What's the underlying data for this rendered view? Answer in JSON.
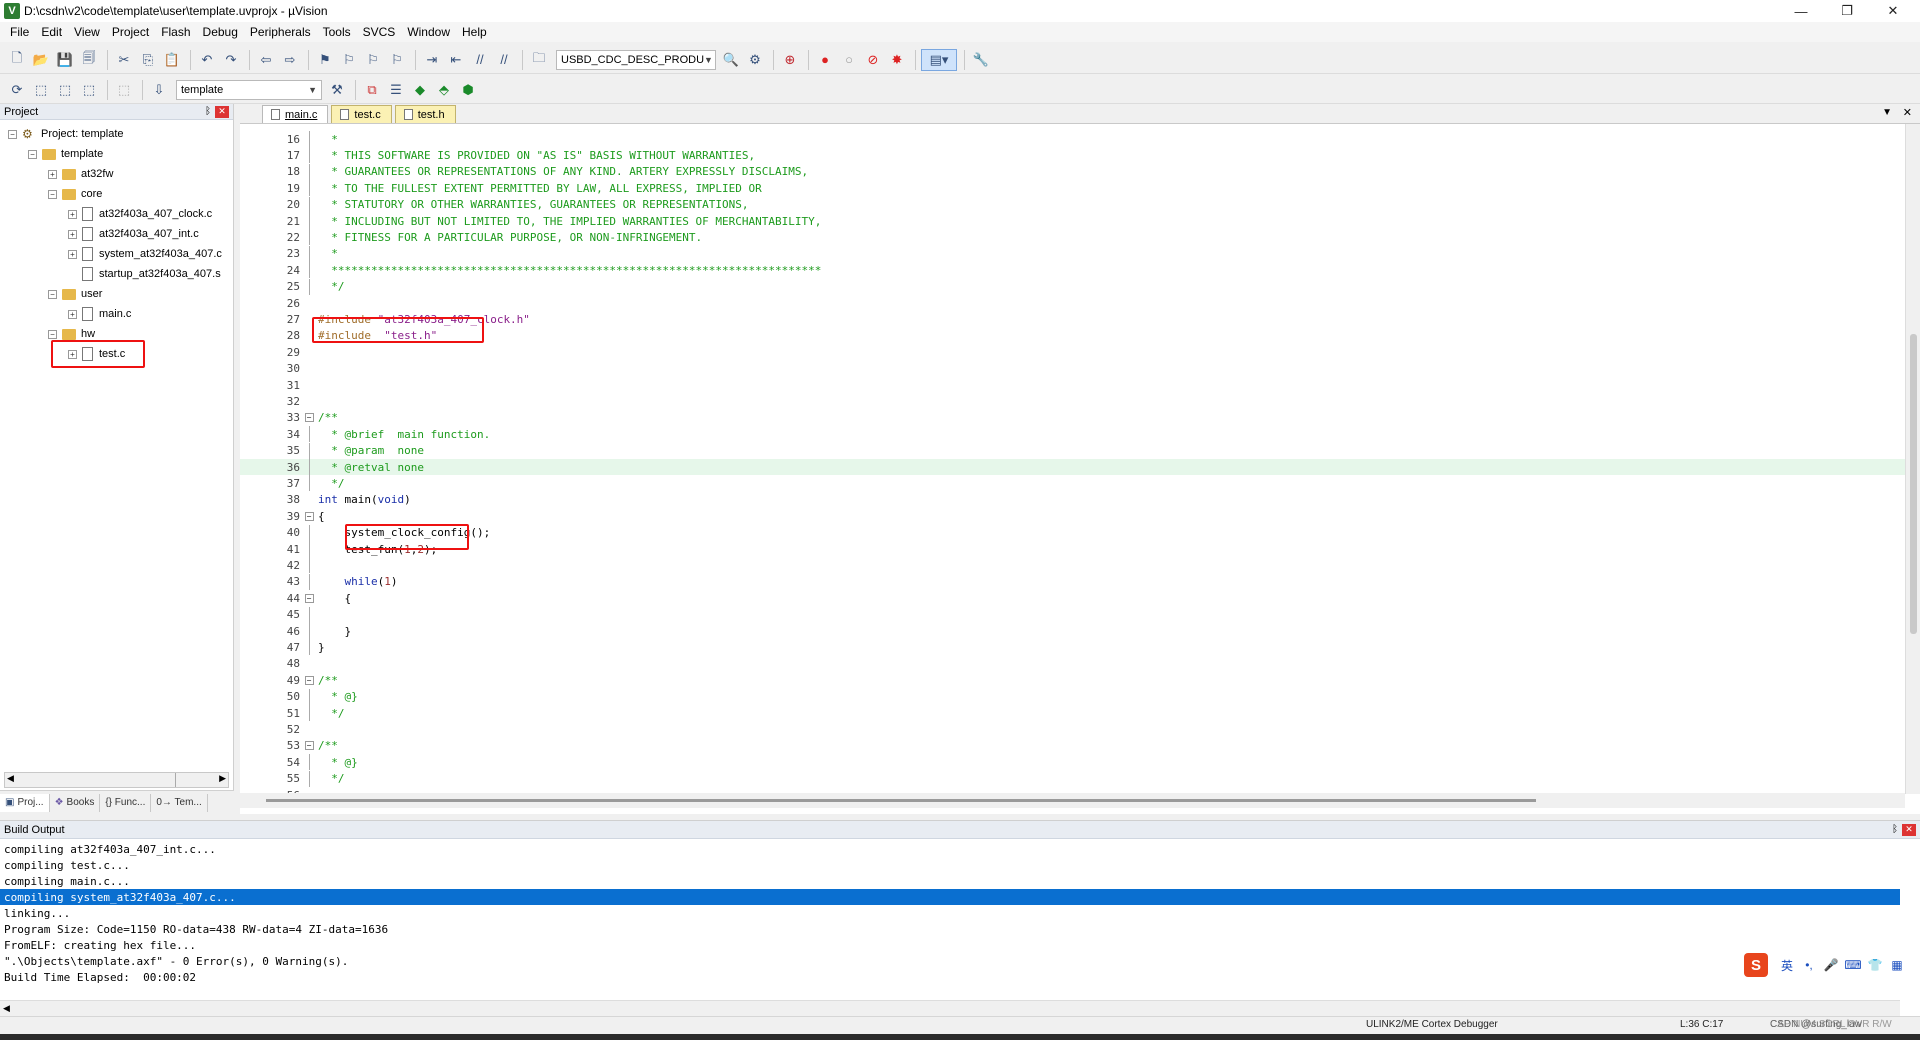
{
  "window": {
    "title": "D:\\csdn\\v2\\code\\template\\user\\template.uvprojx - µVision",
    "icon_letter": "V",
    "controls": {
      "minimize": "—",
      "maximize": "❐",
      "close": "✕"
    }
  },
  "menu": [
    "File",
    "Edit",
    "View",
    "Project",
    "Flash",
    "Debug",
    "Peripherals",
    "Tools",
    "SVCS",
    "Window",
    "Help"
  ],
  "toolbar1": {
    "target_dropdown": "USBD_CDC_DESC_PRODU"
  },
  "toolbar2": {
    "target_select": "template"
  },
  "project_panel": {
    "title": "Project",
    "pin": "ᛒ",
    "close": "✕",
    "tree": [
      {
        "label": "Project: template",
        "level": 0,
        "kind": "project",
        "exp": "−"
      },
      {
        "label": "template",
        "level": 1,
        "kind": "folder",
        "exp": "−"
      },
      {
        "label": "at32fw",
        "level": 2,
        "kind": "folder",
        "exp": "+"
      },
      {
        "label": "core",
        "level": 2,
        "kind": "folder",
        "exp": "−"
      },
      {
        "label": "at32f403a_407_clock.c",
        "level": 3,
        "kind": "file",
        "exp": "+"
      },
      {
        "label": "at32f403a_407_int.c",
        "level": 3,
        "kind": "file",
        "exp": "+"
      },
      {
        "label": "system_at32f403a_407.c",
        "level": 3,
        "kind": "file",
        "exp": "+"
      },
      {
        "label": "startup_at32f403a_407.s",
        "level": 3,
        "kind": "file",
        "exp": ""
      },
      {
        "label": "user",
        "level": 2,
        "kind": "folder",
        "exp": "−"
      },
      {
        "label": "main.c",
        "level": 3,
        "kind": "file",
        "exp": "+"
      },
      {
        "label": "hw",
        "level": 2,
        "kind": "folder",
        "exp": "−"
      },
      {
        "label": "test.c",
        "level": 3,
        "kind": "file",
        "exp": "+"
      }
    ],
    "bottom_tabs": [
      "Proj...",
      "Books",
      "{} Func...",
      "0→ Tem..."
    ]
  },
  "editor": {
    "tabs": [
      {
        "label": "main.c",
        "active": true
      },
      {
        "label": "test.c",
        "active": false
      },
      {
        "label": "test.h",
        "active": false
      }
    ],
    "lines": [
      {
        "n": "16",
        "fold": "line",
        "segs": [
          {
            "t": "  *",
            "c": "comment"
          }
        ]
      },
      {
        "n": "17",
        "fold": "line",
        "segs": [
          {
            "t": "  * THIS SOFTWARE IS PROVIDED ON \"AS IS\" BASIS WITHOUT WARRANTIES,",
            "c": "comment"
          }
        ]
      },
      {
        "n": "18",
        "fold": "line",
        "segs": [
          {
            "t": "  * GUARANTEES OR REPRESENTATIONS OF ANY KIND. ARTERY EXPRESSLY DISCLAIMS,",
            "c": "comment"
          }
        ]
      },
      {
        "n": "19",
        "fold": "line",
        "segs": [
          {
            "t": "  * TO THE FULLEST EXTENT PERMITTED BY LAW, ALL EXPRESS, IMPLIED OR",
            "c": "comment"
          }
        ]
      },
      {
        "n": "20",
        "fold": "line",
        "segs": [
          {
            "t": "  * STATUTORY OR OTHER WARRANTIES, GUARANTEES OR REPRESENTATIONS,",
            "c": "comment"
          }
        ]
      },
      {
        "n": "21",
        "fold": "line",
        "segs": [
          {
            "t": "  * INCLUDING BUT NOT LIMITED TO, THE IMPLIED WARRANTIES OF MERCHANTABILITY,",
            "c": "comment"
          }
        ]
      },
      {
        "n": "22",
        "fold": "line",
        "segs": [
          {
            "t": "  * FITNESS FOR A PARTICULAR PURPOSE, OR NON-INFRINGEMENT.",
            "c": "comment"
          }
        ]
      },
      {
        "n": "23",
        "fold": "line",
        "segs": [
          {
            "t": "  *",
            "c": "comment"
          }
        ]
      },
      {
        "n": "24",
        "fold": "line",
        "segs": [
          {
            "t": "  **************************************************************************",
            "c": "comment"
          }
        ]
      },
      {
        "n": "25",
        "fold": "line",
        "segs": [
          {
            "t": "  */",
            "c": "comment"
          }
        ]
      },
      {
        "n": "26",
        "fold": "",
        "segs": []
      },
      {
        "n": "27",
        "fold": "",
        "segs": [
          {
            "t": "#include ",
            "c": "pp"
          },
          {
            "t": "\"at32f403a_407_clock.h\"",
            "c": "str"
          }
        ]
      },
      {
        "n": "28",
        "fold": "",
        "segs": [
          {
            "t": "#include  ",
            "c": "pp"
          },
          {
            "t": "\"test.h\"",
            "c": "str"
          }
        ]
      },
      {
        "n": "29",
        "fold": "",
        "segs": []
      },
      {
        "n": "30",
        "fold": "",
        "segs": []
      },
      {
        "n": "31",
        "fold": "",
        "segs": []
      },
      {
        "n": "32",
        "fold": "",
        "segs": []
      },
      {
        "n": "33",
        "fold": "box",
        "segs": [
          {
            "t": "/**",
            "c": "comment"
          }
        ]
      },
      {
        "n": "34",
        "fold": "line",
        "segs": [
          {
            "t": "  * @brief  main function.",
            "c": "comment"
          }
        ]
      },
      {
        "n": "35",
        "fold": "line",
        "segs": [
          {
            "t": "  * @param  none",
            "c": "comment"
          }
        ]
      },
      {
        "n": "36",
        "fold": "line",
        "segs": [
          {
            "t": "  * @retval none",
            "c": "comment"
          }
        ],
        "hl": true
      },
      {
        "n": "37",
        "fold": "line",
        "segs": [
          {
            "t": "  */",
            "c": "comment"
          }
        ]
      },
      {
        "n": "38",
        "fold": "",
        "segs": [
          {
            "t": "int",
            "c": "kw"
          },
          {
            "t": " main(",
            "c": "plain"
          },
          {
            "t": "void",
            "c": "kw"
          },
          {
            "t": ")",
            "c": "plain"
          }
        ]
      },
      {
        "n": "39",
        "fold": "box",
        "segs": [
          {
            "t": "{",
            "c": "plain"
          }
        ]
      },
      {
        "n": "40",
        "fold": "line",
        "segs": [
          {
            "t": "    system_clock_config();",
            "c": "plain"
          }
        ]
      },
      {
        "n": "41",
        "fold": "line",
        "segs": [
          {
            "t": "    test_fun(",
            "c": "plain"
          },
          {
            "t": "1",
            "c": "num"
          },
          {
            "t": ",",
            "c": "plain"
          },
          {
            "t": "2",
            "c": "num"
          },
          {
            "t": ");",
            "c": "plain"
          }
        ]
      },
      {
        "n": "42",
        "fold": "line",
        "segs": []
      },
      {
        "n": "43",
        "fold": "line",
        "segs": [
          {
            "t": "    ",
            "c": "plain"
          },
          {
            "t": "while",
            "c": "kw"
          },
          {
            "t": "(",
            "c": "plain"
          },
          {
            "t": "1",
            "c": "num"
          },
          {
            "t": ")",
            "c": "plain"
          }
        ]
      },
      {
        "n": "44",
        "fold": "box",
        "segs": [
          {
            "t": "    {",
            "c": "plain"
          }
        ]
      },
      {
        "n": "45",
        "fold": "line",
        "segs": []
      },
      {
        "n": "46",
        "fold": "line",
        "segs": [
          {
            "t": "    }",
            "c": "plain"
          }
        ]
      },
      {
        "n": "47",
        "fold": "line",
        "segs": [
          {
            "t": "}",
            "c": "plain"
          }
        ]
      },
      {
        "n": "48",
        "fold": "",
        "segs": []
      },
      {
        "n": "49",
        "fold": "box",
        "segs": [
          {
            "t": "/**",
            "c": "comment"
          }
        ]
      },
      {
        "n": "50",
        "fold": "line",
        "segs": [
          {
            "t": "  * @}",
            "c": "comment"
          }
        ]
      },
      {
        "n": "51",
        "fold": "line",
        "segs": [
          {
            "t": "  */",
            "c": "comment"
          }
        ]
      },
      {
        "n": "52",
        "fold": "",
        "segs": []
      },
      {
        "n": "53",
        "fold": "box",
        "segs": [
          {
            "t": "/**",
            "c": "comment"
          }
        ]
      },
      {
        "n": "54",
        "fold": "line",
        "segs": [
          {
            "t": "  * @}",
            "c": "comment"
          }
        ]
      },
      {
        "n": "55",
        "fold": "line",
        "segs": [
          {
            "t": "  */",
            "c": "comment"
          }
        ]
      },
      {
        "n": "56",
        "fold": "",
        "segs": []
      }
    ]
  },
  "build_output": {
    "title": "Build Output",
    "lines": [
      {
        "t": "compiling at32f403a_407_int.c...",
        "sel": false
      },
      {
        "t": "compiling test.c...",
        "sel": false
      },
      {
        "t": "compiling main.c...",
        "sel": false
      },
      {
        "t": "compiling system_at32f403a_407.c...",
        "sel": true
      },
      {
        "t": "linking...",
        "sel": false
      },
      {
        "t": "Program Size: Code=1150 RO-data=438 RW-data=4 ZI-data=1636",
        "sel": false
      },
      {
        "t": "FromELF: creating hex file...",
        "sel": false
      },
      {
        "t": "\".\\Objects\\template.axf\" - 0 Error(s), 0 Warning(s).",
        "sel": false
      },
      {
        "t": "Build Time Elapsed:  00:00:02",
        "sel": false
      }
    ]
  },
  "ime": {
    "logo": "S",
    "lang": "英",
    "icons": [
      "•,",
      "🎤",
      "⌨",
      "👕",
      "▦"
    ]
  },
  "statusbar": {
    "debugger": "ULINK2/ME Cortex Debugger",
    "position": "L:36 C:17",
    "caps": "CAP NUM SCRL OVR R/W",
    "watermark": "CSDN @surfing_law"
  },
  "colors": {
    "accent_red": "#e11111",
    "selection_blue": "#0a6fd0",
    "comment_green": "#1d9b1d"
  }
}
